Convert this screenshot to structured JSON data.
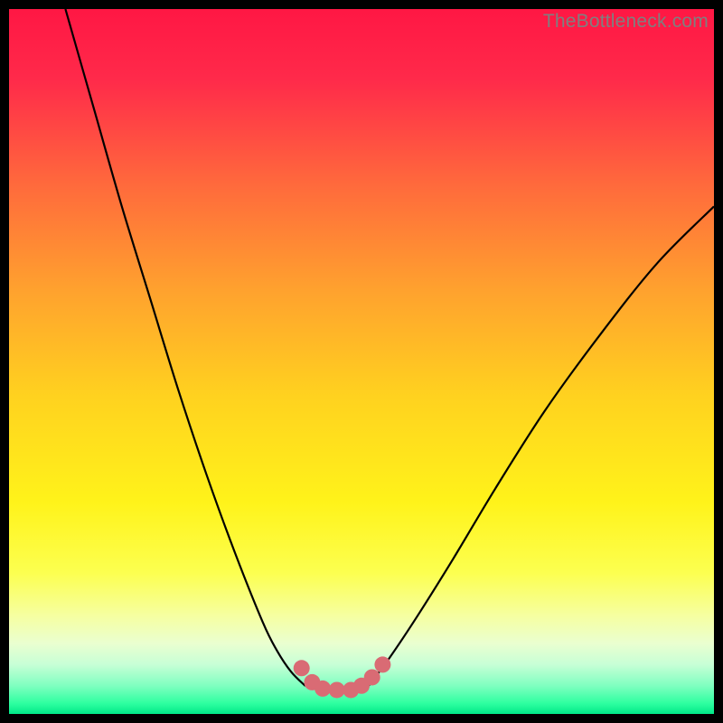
{
  "watermark": "TheBottleneck.com",
  "chart_data": {
    "type": "line",
    "title": "",
    "xlabel": "",
    "ylabel": "",
    "xlim": [
      0,
      100
    ],
    "ylim": [
      0,
      100
    ],
    "series": [
      {
        "name": "bottleneck-curve-left",
        "x": [
          8,
          12,
          16,
          20,
          24,
          28,
          32,
          36,
          38,
          40,
          42
        ],
        "y": [
          100,
          86,
          72,
          59,
          46,
          34,
          23,
          13,
          9,
          6,
          4
        ]
      },
      {
        "name": "bottleneck-curve-right",
        "x": [
          51,
          54,
          58,
          63,
          69,
          76,
          84,
          92,
          100
        ],
        "y": [
          4,
          8,
          14,
          22,
          32,
          43,
          54,
          64,
          72
        ]
      },
      {
        "name": "bottleneck-flat",
        "x": [
          42,
          44,
          46,
          48,
          50,
          51
        ],
        "y": [
          4,
          3.5,
          3.4,
          3.4,
          3.6,
          4
        ]
      }
    ],
    "markers": {
      "name": "highlight-dots",
      "color": "#d96b74",
      "points": [
        {
          "x": 41.5,
          "y": 6.5
        },
        {
          "x": 43.0,
          "y": 4.5
        },
        {
          "x": 44.5,
          "y": 3.6
        },
        {
          "x": 46.5,
          "y": 3.4
        },
        {
          "x": 48.5,
          "y": 3.4
        },
        {
          "x": 50.0,
          "y": 4.0
        },
        {
          "x": 51.5,
          "y": 5.2
        },
        {
          "x": 53.0,
          "y": 7.0
        }
      ]
    },
    "gradient_stops": [
      {
        "offset": 0.0,
        "color": "#ff1744"
      },
      {
        "offset": 0.1,
        "color": "#ff2a4a"
      },
      {
        "offset": 0.25,
        "color": "#ff6a3c"
      },
      {
        "offset": 0.4,
        "color": "#ffa22e"
      },
      {
        "offset": 0.55,
        "color": "#ffd21f"
      },
      {
        "offset": 0.7,
        "color": "#fff31a"
      },
      {
        "offset": 0.8,
        "color": "#fcff50"
      },
      {
        "offset": 0.86,
        "color": "#f6ffa0"
      },
      {
        "offset": 0.9,
        "color": "#eaffd0"
      },
      {
        "offset": 0.93,
        "color": "#c7ffd6"
      },
      {
        "offset": 0.96,
        "color": "#7fffc0"
      },
      {
        "offset": 0.985,
        "color": "#2effa0"
      },
      {
        "offset": 1.0,
        "color": "#00e888"
      }
    ]
  }
}
